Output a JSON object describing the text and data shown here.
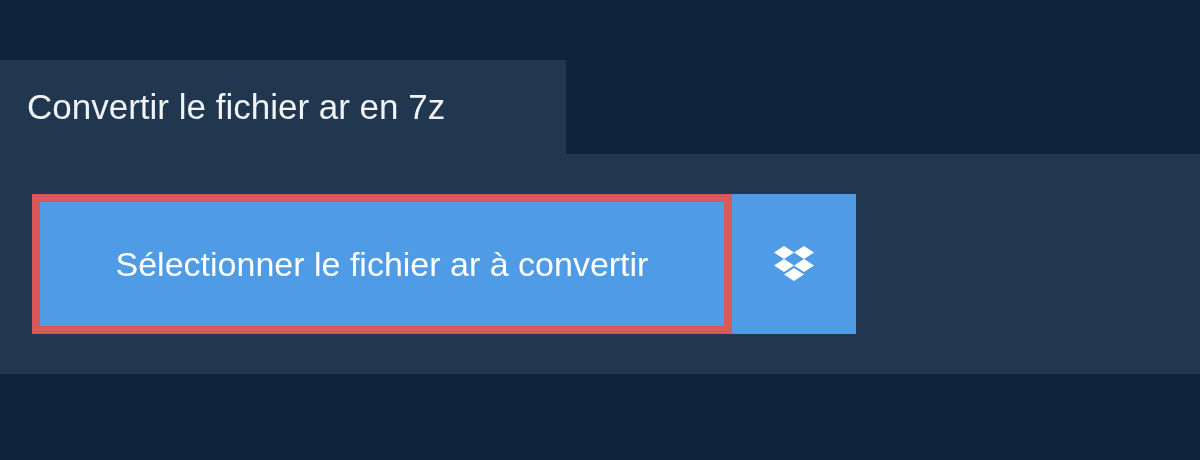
{
  "tab": {
    "title": "Convertir le fichier ar en 7z"
  },
  "buttons": [
    {
      "kind": "select",
      "label": "Sélectionner le fichier ar à convertir"
    },
    {
      "kind": "dropbox"
    }
  ]
}
